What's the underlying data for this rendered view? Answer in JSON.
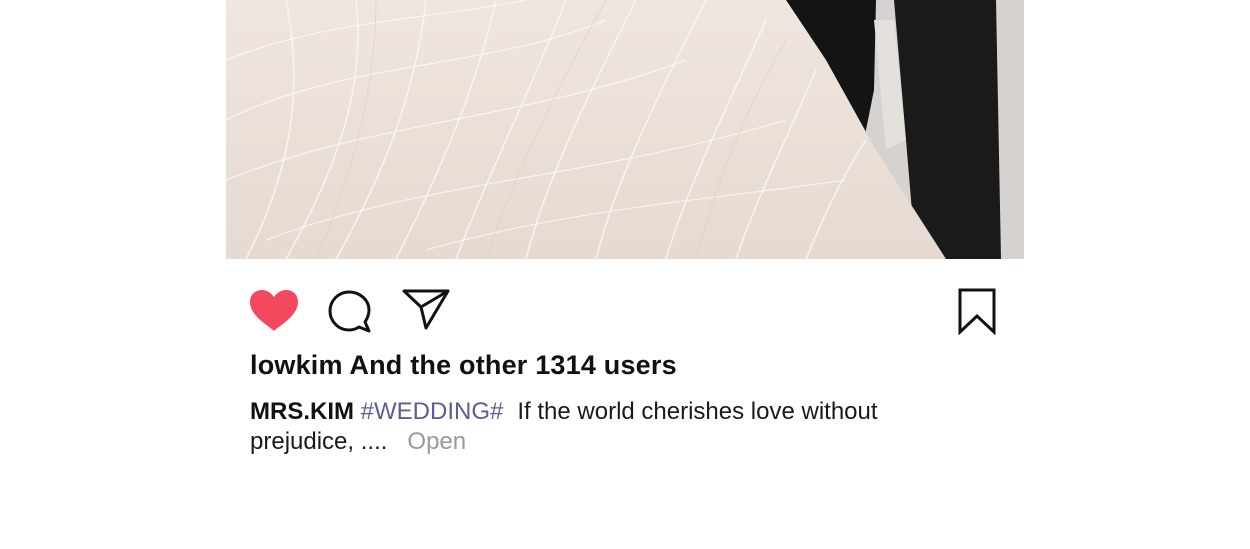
{
  "post": {
    "image_icon": "wedding-photo",
    "likes_text": "lowkim And the other 1314 users",
    "caption": {
      "author": "MRS.KIM",
      "hashtag": "#WEDDING#",
      "text": "If the world cherishes love without prejudice, ....",
      "more_label": "Open"
    }
  },
  "actions": {
    "like_icon": "heart-icon",
    "comment_icon": "comment-icon",
    "share_icon": "send-icon",
    "save_icon": "bookmark-icon",
    "like_color": "#f4485e"
  }
}
